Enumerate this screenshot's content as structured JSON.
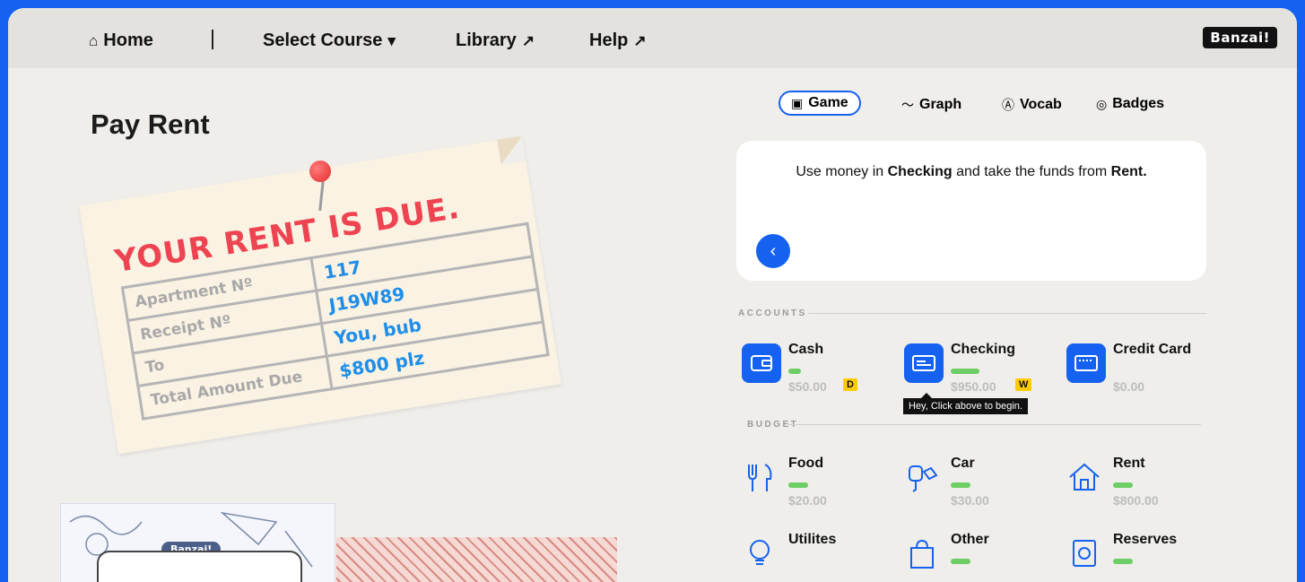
{
  "nav": {
    "home": "Home",
    "select_course": "Select Course",
    "library": "Library",
    "help": "Help",
    "logo": "Banzai!"
  },
  "page_title": "Pay Rent",
  "notice": {
    "heading": "YOUR RENT IS DUE.",
    "rows": [
      {
        "label": "Apartment Nº",
        "value": "117"
      },
      {
        "label": "Receipt Nº",
        "value": "J19W89"
      },
      {
        "label": "To",
        "value": "You, bub"
      },
      {
        "label": "Total Amount Due",
        "value": "$800 plz"
      }
    ]
  },
  "book_badge": "Banzai!",
  "tabs": [
    {
      "label": "Game",
      "icon": "gamepad-icon",
      "active": true
    },
    {
      "label": "Graph",
      "icon": "trend-icon",
      "active": false
    },
    {
      "label": "Vocab",
      "icon": "letter-icon",
      "active": false
    },
    {
      "label": "Badges",
      "icon": "badge-icon",
      "active": false
    }
  ],
  "instruction": {
    "pre": "Use money in ",
    "b1": "Checking",
    "mid": " and take the funds from ",
    "b2": "Rent."
  },
  "accounts_label": "ACCOUNTS",
  "accounts": [
    {
      "name": "Cash",
      "amount": "$50.00",
      "tag": "D",
      "icon": "wallet-icon"
    },
    {
      "name": "Checking",
      "amount": "$950.00",
      "tag": "W",
      "icon": "check-icon"
    },
    {
      "name": "Credit Card",
      "amount": "$0.00",
      "tag": "",
      "icon": "credit-card-icon"
    }
  ],
  "budget_label": "BUDGET",
  "budget": [
    {
      "name": "Food",
      "amount": "$20.00",
      "icon": "utensils-icon"
    },
    {
      "name": "Car",
      "amount": "$30.00",
      "icon": "car-key-icon"
    },
    {
      "name": "Rent",
      "amount": "$800.00",
      "icon": "house-icon"
    },
    {
      "name": "Utilites",
      "amount": "",
      "icon": "bulb-icon"
    },
    {
      "name": "Other",
      "amount": "",
      "icon": "bag-icon"
    },
    {
      "name": "Reserves",
      "amount": "",
      "icon": "safe-icon"
    }
  ],
  "tooltip": "Hey, Click above to begin.",
  "colors": {
    "accent": "#1662f0",
    "bar": "#6cce64",
    "alert": "#ee4452"
  }
}
